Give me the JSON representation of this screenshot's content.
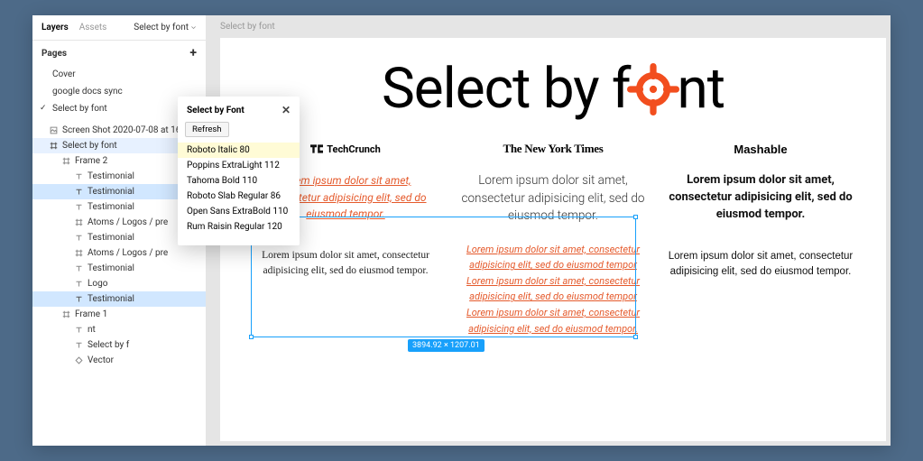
{
  "tabs": {
    "layers": "Layers",
    "assets": "Assets",
    "breadcrumb": "Select by font"
  },
  "pages": {
    "header": "Pages",
    "items": [
      {
        "label": "Cover",
        "checked": false
      },
      {
        "label": "google docs sync",
        "checked": false
      },
      {
        "label": "Select by font",
        "checked": true
      }
    ]
  },
  "layers": [
    {
      "depth": 0,
      "icon": "image",
      "label": "Screen Shot 2020-07-08 at 16",
      "sel": ""
    },
    {
      "depth": 0,
      "icon": "frame",
      "label": "Select by font",
      "sel": "sel2"
    },
    {
      "depth": 1,
      "icon": "frame",
      "label": "Frame 2",
      "sel": ""
    },
    {
      "depth": 2,
      "icon": "text",
      "label": "Testimonial",
      "sel": ""
    },
    {
      "depth": 2,
      "icon": "text",
      "label": "Testimonial",
      "sel": "sel"
    },
    {
      "depth": 2,
      "icon": "text",
      "label": "Testimonial",
      "sel": ""
    },
    {
      "depth": 2,
      "icon": "frame",
      "label": "Atoms / Logos / pre",
      "sel": ""
    },
    {
      "depth": 2,
      "icon": "text",
      "label": "Testimonial",
      "sel": ""
    },
    {
      "depth": 2,
      "icon": "frame",
      "label": "Atoms / Logos / pre",
      "sel": ""
    },
    {
      "depth": 2,
      "icon": "text",
      "label": "Testimonial",
      "sel": ""
    },
    {
      "depth": 2,
      "icon": "text",
      "label": "Logo",
      "sel": ""
    },
    {
      "depth": 2,
      "icon": "text",
      "label": "Testimonial",
      "sel": "sel"
    },
    {
      "depth": 1,
      "icon": "frame",
      "label": "Frame 1",
      "sel": ""
    },
    {
      "depth": 2,
      "icon": "text",
      "label": "nt",
      "sel": ""
    },
    {
      "depth": 2,
      "icon": "text",
      "label": "Select by f",
      "sel": ""
    },
    {
      "depth": 2,
      "icon": "vector",
      "label": "Vector",
      "sel": ""
    }
  ],
  "popup": {
    "title": "Select by Font",
    "refresh": "Refresh",
    "fonts": [
      {
        "label": "Roboto Italic 80",
        "hl": true
      },
      {
        "label": "Poppins ExtraLight 112",
        "hl": false
      },
      {
        "label": "Tahoma Bold 110",
        "hl": false
      },
      {
        "label": "Roboto Slab Regular 86",
        "hl": false
      },
      {
        "label": "Open Sans ExtraBold 110",
        "hl": false
      },
      {
        "label": "Rum Raisin Regular 120",
        "hl": false
      }
    ]
  },
  "canvas": {
    "frame_label": "Select by font",
    "hero_a": "Select by f",
    "hero_b": "nt",
    "logos": {
      "tc": "TechCrunch",
      "nyt": "The New York Times",
      "mash": "Mashable"
    },
    "txt": {
      "p1": "Lorem ipsum dolor sit amet, consectetur adipisicing elit, sed do eiusmod tempor.",
      "p2": "Lorem ipsum dolor sit amet, consectetur adipisicing elit, sed do eiusmod tempor.",
      "p3": "Lorem ipsum dolor sit amet, consectetur adipisicing elit, sed do eiusmod tempor.",
      "p4": "Lorem ipsum dolor sit amet, consectetur adipisicing elit, sed do eiusmod tempor.",
      "p5": "Lorem ipsum dolor sit amet, consectetur adipisicing elit, sed do eiusmod tempor Lorem ipsum dolor sit amet, consectetur adipisicing elit, sed do eiusmod tempor Lorem ipsum dolor sit amet, consectetur adipisicing elit, sed do eiusmod tempor.",
      "p6": "Lorem ipsum dolor sit amet, consectetur adipisicing elit, sed do eiusmod tempor."
    },
    "selection_dim": "3894.92 × 1207.01"
  }
}
